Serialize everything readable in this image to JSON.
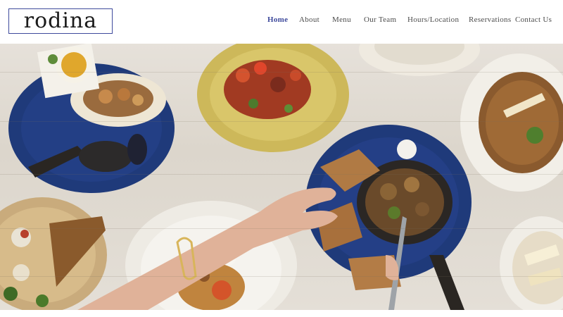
{
  "brand": {
    "name": "rodina"
  },
  "nav": {
    "items": [
      {
        "label": "Home",
        "active": true
      },
      {
        "label": "About",
        "active": false
      },
      {
        "label": "Menu",
        "active": false
      },
      {
        "label": "Our Team",
        "active": false
      },
      {
        "label": "Hours/Location",
        "active": false
      },
      {
        "label": "Reservations",
        "active": false
      },
      {
        "label": "Contact Us",
        "active": false
      }
    ]
  },
  "colors": {
    "accent": "#3e4a9c",
    "nav_text": "#4b4b4b",
    "plate_blue": "#1f3a7a",
    "plate_yellow": "#d9c66a"
  },
  "hero": {
    "description_icon": "food-spread-photo"
  }
}
